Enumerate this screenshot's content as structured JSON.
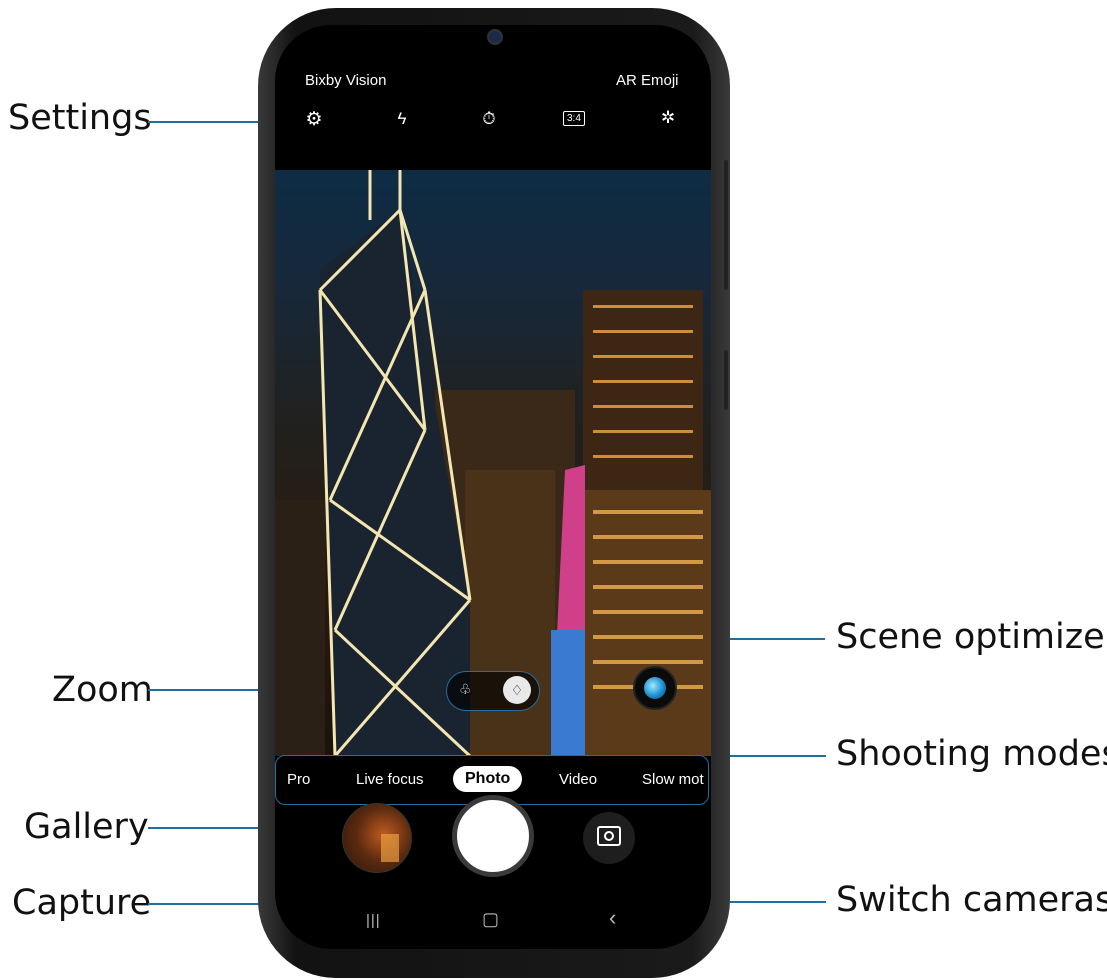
{
  "callouts": {
    "settings": "Settings",
    "zoom": "Zoom",
    "gallery": "Gallery",
    "capture": "Capture",
    "scene_optimizer": "Scene optimizer",
    "shooting_modes": "Shooting modes",
    "switch_cameras": "Switch cameras"
  },
  "top_bar": {
    "left_label": "Bixby Vision",
    "right_label": "AR Emoji"
  },
  "quick_settings": {
    "settings_icon": "⚙",
    "flash_icon": "ϟ",
    "timer_icon": "⏱",
    "ratio_label": "3:4",
    "filters_icon": "✲"
  },
  "modes": [
    "Pro",
    "Live focus",
    "Photo",
    "Video",
    "Slow mot"
  ],
  "active_mode": "Photo",
  "nav": {
    "recents": "|||",
    "home": "▢",
    "back": "‹"
  },
  "zoom": {
    "wide_icon": "♧",
    "normal_icon": "♢"
  },
  "colors": {
    "leader": "#1f6fa3",
    "phone_body": "#1a1a1a"
  }
}
